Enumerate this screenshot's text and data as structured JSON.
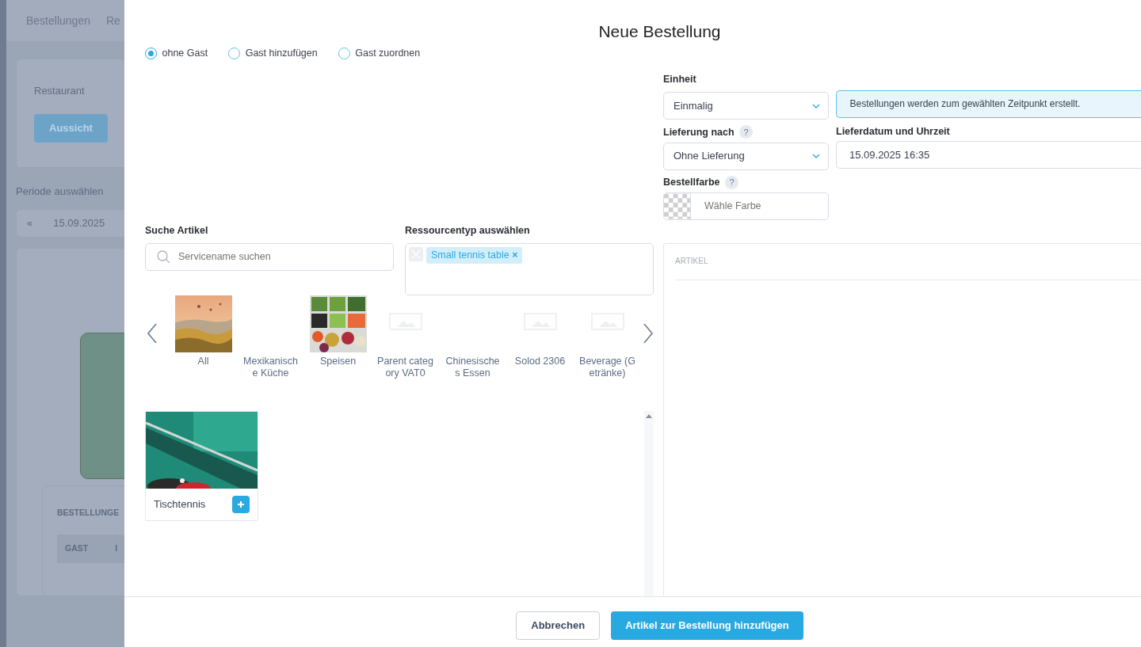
{
  "background": {
    "nav": [
      "Bestellungen",
      "Re"
    ],
    "restaurant_label": "Restaurant",
    "view_button": "Aussicht",
    "period_label": "Periode auswählen",
    "period_prev": "«",
    "period_date": "15.09.2025",
    "orders_heading": "BESTELLUNGE",
    "table_columns": [
      "GAST",
      "I"
    ]
  },
  "modal": {
    "title": "Neue Bestellung",
    "guest_options": [
      {
        "label": "ohne Gast",
        "selected": true
      },
      {
        "label": "Gast hinzufügen",
        "selected": false
      },
      {
        "label": "Gast zuordnen",
        "selected": false
      }
    ],
    "search": {
      "label": "Suche Artikel",
      "placeholder": "Servicename suchen"
    },
    "resource_type": {
      "label": "Ressourcentyp auswählen",
      "tags": [
        {
          "label": "Small tennis table",
          "remove": "×"
        }
      ]
    },
    "categories": [
      {
        "label": "All",
        "kind": "landscape"
      },
      {
        "label": "Mexikanische Küche",
        "kind": "none"
      },
      {
        "label": "Speisen",
        "kind": "food"
      },
      {
        "label": "Parent category VAT0",
        "kind": "placeholder"
      },
      {
        "label": "Chinesische s Essen",
        "kind": "none"
      },
      {
        "label": "Solod 2306",
        "kind": "placeholder"
      },
      {
        "label": "Beverage (Getränke)",
        "kind": "placeholder"
      }
    ],
    "products": [
      {
        "name": "Tischtennis"
      }
    ],
    "unit": {
      "label": "Einheit",
      "value": "Einmalig"
    },
    "info": "Bestellungen werden zum gewählten Zeitpunkt erstellt.",
    "delivery": {
      "label": "Lieferung nach",
      "help": "?",
      "value": "Ohne Lieferung"
    },
    "delivery_datetime": {
      "label": "Lieferdatum und Uhrzeit",
      "value": "15.09.2025 16:35"
    },
    "order_color": {
      "label": "Bestellfarbe",
      "help": "?",
      "placeholder": "Wähle Farbe"
    },
    "articles_panel": {
      "heading": "ARTIKEL"
    },
    "buttons": [
      {
        "label": "Abbrechen",
        "kind": "secondary"
      },
      {
        "label": "Artikel zur Bestellung hinzufügen",
        "kind": "primary"
      }
    ]
  }
}
